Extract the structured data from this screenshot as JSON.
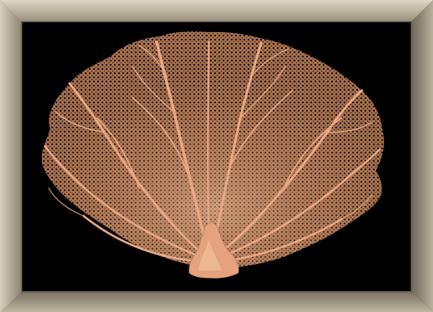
{
  "artwork": {
    "subject": "sea-fan-coral",
    "colors": {
      "background": "#000000",
      "coral_light": "#f0b48c",
      "coral_mid": "#c98a63",
      "coral_dark": "#8a5538",
      "frame_light": "#d8d0c0",
      "frame_mid": "#a79d88",
      "frame_dark": "#6d6557"
    }
  }
}
